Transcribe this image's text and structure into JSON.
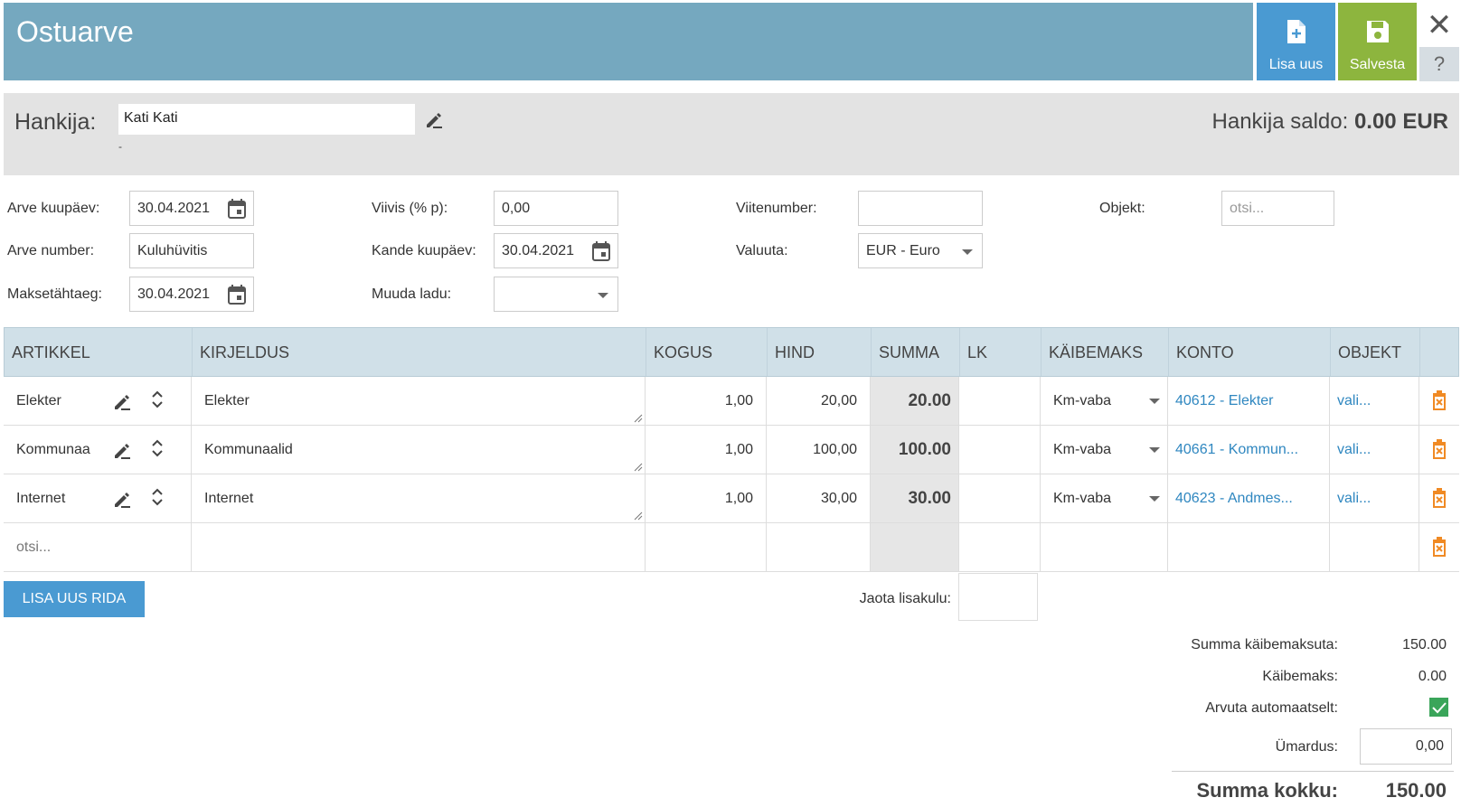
{
  "header": {
    "title": "Ostuarve",
    "new_label": "Lisa uus",
    "save_label": "Salvesta",
    "help": "?"
  },
  "supplier": {
    "label": "Hankija:",
    "value": "Kati Kati",
    "sub": "-",
    "saldo_label": "Hankija saldo:",
    "saldo_value": "0.00 EUR"
  },
  "form": {
    "invoice_date_label": "Arve kuupäev:",
    "invoice_date": "30.04.2021",
    "invoice_no_label": "Arve number:",
    "invoice_no": "Kuluhüvitis",
    "due_date_label": "Maksetähtaeg:",
    "due_date": "30.04.2021",
    "penalty_label": "Viivis (% p):",
    "penalty": "0,00",
    "entry_date_label": "Kande kuupäev:",
    "entry_date": "30.04.2021",
    "warehouse_label": "Muuda ladu:",
    "warehouse": "",
    "ref_label": "Viitenumber:",
    "ref": "",
    "currency_label": "Valuuta:",
    "currency": "EUR - Euro",
    "object_label": "Objekt:",
    "object_placeholder": "otsi..."
  },
  "table": {
    "headers": [
      "ARTIKKEL",
      "KIRJELDUS",
      "KOGUS",
      "HIND",
      "SUMMA",
      "LK",
      "KÄIBEMAKS",
      "KONTO",
      "OBJEKT"
    ],
    "rows": [
      {
        "article": "Elekter",
        "description": "Elekter",
        "qty": "1,00",
        "price": "20,00",
        "sum": "20.00",
        "vat": "Km-vaba",
        "account": "40612 - Elekter",
        "object": "vali..."
      },
      {
        "article": "Kommunaa",
        "description": "Kommunaalid",
        "qty": "1,00",
        "price": "100,00",
        "sum": "100.00",
        "vat": "Km-vaba",
        "account": "40661 - Kommun...",
        "object": "vali..."
      },
      {
        "article": "Internet",
        "description": "Internet",
        "qty": "1,00",
        "price": "30,00",
        "sum": "30.00",
        "vat": "Km-vaba",
        "account": "40623 - Andmes...",
        "object": "vali..."
      }
    ],
    "search_placeholder": "otsi..."
  },
  "add_row_label": "LISA UUS RIDA",
  "extra_cost_label": "Jaota lisakulu:",
  "totals": {
    "net_label": "Summa käibemaksuta:",
    "net": "150.00",
    "vat_label": "Käibemaks:",
    "vat": "0.00",
    "auto_label": "Arvuta automaatselt:",
    "rounding_label": "Ümardus:",
    "rounding": "0,00",
    "total_label": "Summa kokku:",
    "total": "150.00"
  },
  "colors": {
    "header": "#75a8bf",
    "new_button": "#4a9ad2",
    "save_button": "#8db53e",
    "link": "#2f87c0",
    "delete": "#f08a24",
    "check": "#3aa55a"
  }
}
